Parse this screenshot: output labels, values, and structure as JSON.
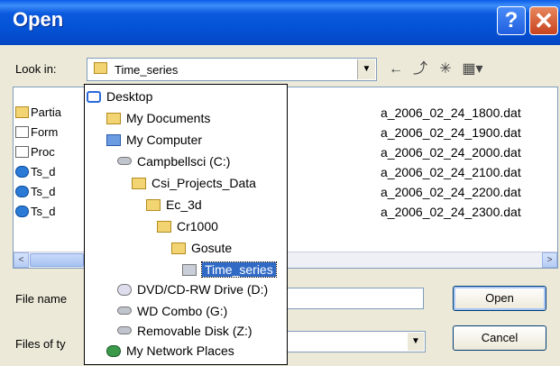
{
  "window": {
    "title": "Open",
    "help_glyph": "?",
    "close_glyph": "✕"
  },
  "lookin": {
    "label": "Look in:",
    "value": "Time_series"
  },
  "toolbar": {
    "icons": [
      "back-icon",
      "up-folder-icon",
      "new-folder-icon",
      "view-menu-icon"
    ]
  },
  "files": {
    "left": [
      {
        "name": "Partia",
        "icon": "folder-icon"
      },
      {
        "name": "Form",
        "icon": "document-icon"
      },
      {
        "name": "Proc",
        "icon": "document-icon"
      },
      {
        "name": "Ts_d",
        "icon": "app-icon"
      },
      {
        "name": "Ts_d",
        "icon": "app-icon"
      },
      {
        "name": "Ts_d",
        "icon": "app-icon"
      }
    ],
    "right": [
      "a_2006_02_24_1800.dat",
      "a_2006_02_24_1900.dat",
      "a_2006_02_24_2000.dat",
      "a_2006_02_24_2100.dat",
      "a_2006_02_24_2200.dat",
      "a_2006_02_24_2300.dat"
    ]
  },
  "scroll": {
    "left": "<",
    "right": ">"
  },
  "file_name": {
    "label": "File name",
    "value": ""
  },
  "file_type": {
    "label": "Files of ty",
    "value": ""
  },
  "buttons": {
    "open": "Open",
    "cancel": "Cancel"
  },
  "dropdown": {
    "items": [
      {
        "label": "Desktop",
        "icon": "desktop-icon",
        "level": 0
      },
      {
        "label": "My Documents",
        "icon": "my-documents-icon",
        "level": 1
      },
      {
        "label": "My Computer",
        "icon": "my-computer-icon",
        "level": 1
      },
      {
        "label": "Campbellsci (C:)",
        "icon": "hard-drive-icon",
        "level": 2
      },
      {
        "label": "Csi_Projects_Data",
        "icon": "folder-icon",
        "level": 3
      },
      {
        "label": "Ec_3d",
        "icon": "folder-icon",
        "level": 4
      },
      {
        "label": "Cr1000",
        "icon": "folder-icon",
        "level": 5
      },
      {
        "label": "Gosute",
        "icon": "folder-icon",
        "level": 6
      },
      {
        "label": "Time_series",
        "icon": "folder-icon",
        "level": 7,
        "selected": true
      },
      {
        "label": "DVD/CD-RW Drive (D:)",
        "icon": "dvd-drive-icon",
        "level": 2
      },
      {
        "label": "WD Combo (G:)",
        "icon": "hard-drive-icon",
        "level": 2
      },
      {
        "label": "Removable Disk (Z:)",
        "icon": "removable-disk-icon",
        "level": 2
      },
      {
        "label": "My Network Places",
        "icon": "network-places-icon",
        "level": 1
      }
    ]
  }
}
